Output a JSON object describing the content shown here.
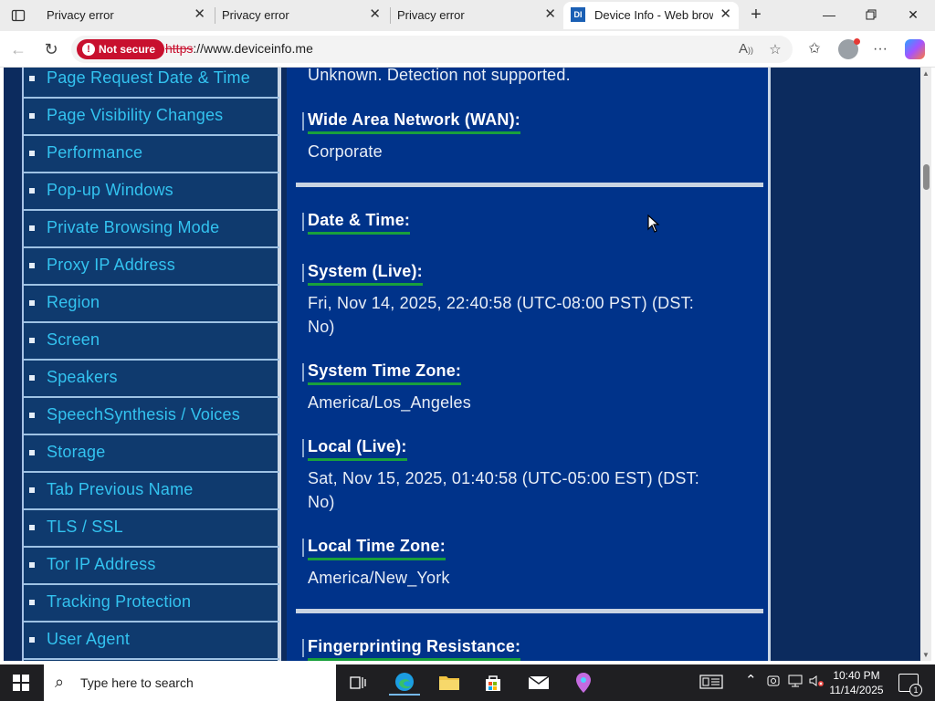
{
  "browser": {
    "tabs": [
      {
        "title": "Privacy error",
        "active": false
      },
      {
        "title": "Privacy error",
        "active": false
      },
      {
        "title": "Privacy error",
        "active": false
      },
      {
        "title": "Device Info - Web brows",
        "active": true,
        "favicon": "DI"
      }
    ],
    "security_label": "Not secure",
    "url_scheme": "https",
    "url_rest": "://www.deviceinfo.me"
  },
  "sidebar": {
    "items": [
      "Page Request Date & Time",
      "Page Visibility Changes",
      "Performance",
      "Pop-up Windows",
      "Private Browsing Mode",
      "Proxy IP Address",
      "Region",
      "Screen",
      "Speakers",
      "SpeechSynthesis / Voices",
      "Storage",
      "Tab Previous Name",
      "TLS / SSL",
      "Tor IP Address",
      "Tracking Protection",
      "User Agent"
    ]
  },
  "content": {
    "top_partial_text": "Unknown. Detection not supported.",
    "wan_heading": "Wide Area Network (WAN):",
    "wan_value": "Corporate",
    "datetime_heading": "Date & Time:",
    "system_live_heading": "System (Live):",
    "system_live_line1": "Fri, Nov 14, 2025, 22:40:58  (UTC-08:00 PST) (DST:",
    "system_live_line2": "No)",
    "system_tz_heading": "System Time Zone:",
    "system_tz_value": "America/Los_Angeles",
    "local_live_heading": "Local (Live):",
    "local_live_line1": "Sat, Nov 15, 2025, 01:40:58  (UTC-05:00 EST) (DST:",
    "local_live_line2": "No)",
    "local_tz_heading": "Local Time Zone:",
    "local_tz_value": "America/New_York",
    "fingerprint_heading": "Fingerprinting Resistance:"
  },
  "taskbar": {
    "search_placeholder": "Type here to search",
    "time": "10:40 PM",
    "date": "11/14/2025",
    "notification_count": "1"
  },
  "colors": {
    "page_background": "#0c2b5e",
    "content_background": "#00338a",
    "sidebar_link": "#33c3f0",
    "heading_underline": "#19a03c",
    "not_secure": "#c8102e"
  }
}
